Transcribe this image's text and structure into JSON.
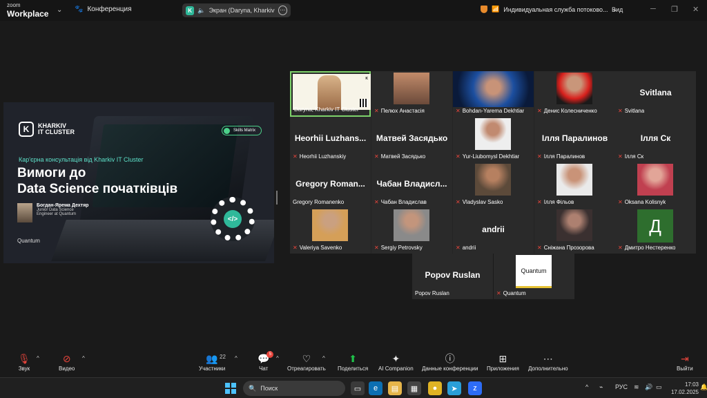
{
  "topbar": {
    "brand_small": "zoom",
    "brand_big": "Workplace",
    "conference_label": "Конференция",
    "share_label": "Экран (Daryna, Kharkiv IT Cl",
    "share_more": "⋯",
    "service_label": "Индивидуальная служба потоково...",
    "view_label": "Вид"
  },
  "slide": {
    "logo_letter": "K",
    "logo_line1": "KHARKIV",
    "logo_line2": "IT CLUSTER",
    "skills": "Skills Matrix",
    "subtitle": "Кар'єрна консультація від Kharkiv IT Cluster",
    "title_line1": "Вимоги до",
    "title_line2": "Data Science початківців",
    "speaker_name": "Богдан-Ярема Дехтяр",
    "speaker_role1": "Junior Data Science",
    "speaker_role2": "Engineer at Quantum",
    "quantum_logo": "Quantum",
    "gear_code": "</>"
  },
  "participants": [
    {
      "name": "Daryna, Kharkiv IT Cluster",
      "muted": false,
      "kind": "share"
    },
    {
      "name": "Пелюх Анастасія",
      "muted": true,
      "kind": "video"
    },
    {
      "name": "Bohdan-Yarema Dekhtiar",
      "muted": true,
      "kind": "video"
    },
    {
      "name": "Денис Колесниченко",
      "muted": true,
      "kind": "video"
    },
    {
      "name": "Svitlana",
      "display": "Svitlana",
      "muted": true,
      "kind": "name"
    },
    {
      "name": "Heorhii Luzhanskiy",
      "display": "Heorhii  Luzhans...",
      "muted": true,
      "kind": "name"
    },
    {
      "name": "Матвей Засядько",
      "display": "Матвей Засядько",
      "muted": true,
      "kind": "name"
    },
    {
      "name": "Yur-Liubomysl Dekhtiar",
      "muted": true,
      "kind": "video"
    },
    {
      "name": "Ілля Паралинов",
      "display": "Ілля Паралинов",
      "muted": true,
      "kind": "name"
    },
    {
      "name": "Ілля Ск",
      "display": "Ілля Ск",
      "muted": true,
      "kind": "name"
    },
    {
      "name": "Gregory Romanenko",
      "display": "Gregory  Roman...",
      "muted": false,
      "kind": "name"
    },
    {
      "name": "Чабан Владислав",
      "display": "Чабан  Владисл...",
      "muted": true,
      "kind": "name"
    },
    {
      "name": "Vladyslav Sasko",
      "muted": true,
      "kind": "video"
    },
    {
      "name": "Ілля Фільов",
      "muted": true,
      "kind": "video"
    },
    {
      "name": "Oksana Kolisnyk",
      "muted": true,
      "kind": "video"
    },
    {
      "name": "Valeriya Savenko",
      "muted": true,
      "kind": "video"
    },
    {
      "name": "Sergiy Petrovsky",
      "muted": true,
      "kind": "video"
    },
    {
      "name": "andrii",
      "display": "andrii",
      "muted": true,
      "kind": "name"
    },
    {
      "name": "Сніжана Прозорова",
      "muted": true,
      "kind": "video"
    },
    {
      "name": "Дмитро Нестеренко",
      "letter": "Д",
      "muted": true,
      "kind": "letter"
    },
    {
      "name": "Popov Ruslan",
      "display": "Popov Ruslan",
      "muted": false,
      "kind": "name"
    },
    {
      "name": "Quantum",
      "logo_text": "Quantum",
      "muted": true,
      "kind": "logo"
    }
  ],
  "toolbar": {
    "audio": "Звук",
    "video": "Видео",
    "participants": "Участники",
    "participants_count": "22",
    "chat": "Чат",
    "chat_badge": "5",
    "react": "Отреагировать",
    "share": "Поделиться",
    "ai": "AI Companion",
    "info": "Данные конференции",
    "apps": "Приложения",
    "more": "Дополнительно",
    "leave": "Выйти"
  },
  "taskbar": {
    "search_placeholder": "Поиск",
    "lang": "РУС",
    "time": "17:03",
    "date": "17.02.2025"
  },
  "colors": {
    "active_speaker": "#7ed36b",
    "muted": "#e8453c",
    "accent": "#2fb99a"
  }
}
